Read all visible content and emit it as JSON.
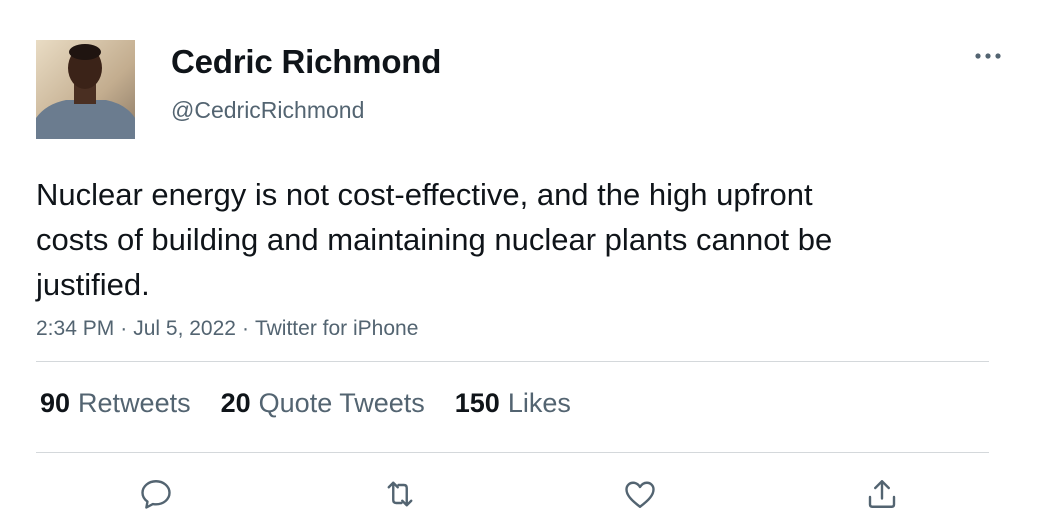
{
  "author": {
    "display_name": "Cedric Richmond",
    "handle": "@CedricRichmond"
  },
  "tweet": {
    "text": "Nuclear energy is not cost-effective, and the high upfront costs of building and maintaining nuclear plants cannot be justified.",
    "time": "2:34 PM",
    "date": "Jul 5, 2022",
    "source": "Twitter for iPhone",
    "separator": "·"
  },
  "stats": {
    "retweets_count": "90",
    "retweets_label": "Retweets",
    "quotes_count": "20",
    "quotes_label": "Quote Tweets",
    "likes_count": "150",
    "likes_label": "Likes"
  },
  "actions": {
    "reply_icon": "reply-icon",
    "retweet_icon": "retweet-icon",
    "like_icon": "heart-icon",
    "share_icon": "share-icon"
  },
  "colors": {
    "text": "#0f1419",
    "secondary": "#536471",
    "divider": "#d4d8db"
  }
}
